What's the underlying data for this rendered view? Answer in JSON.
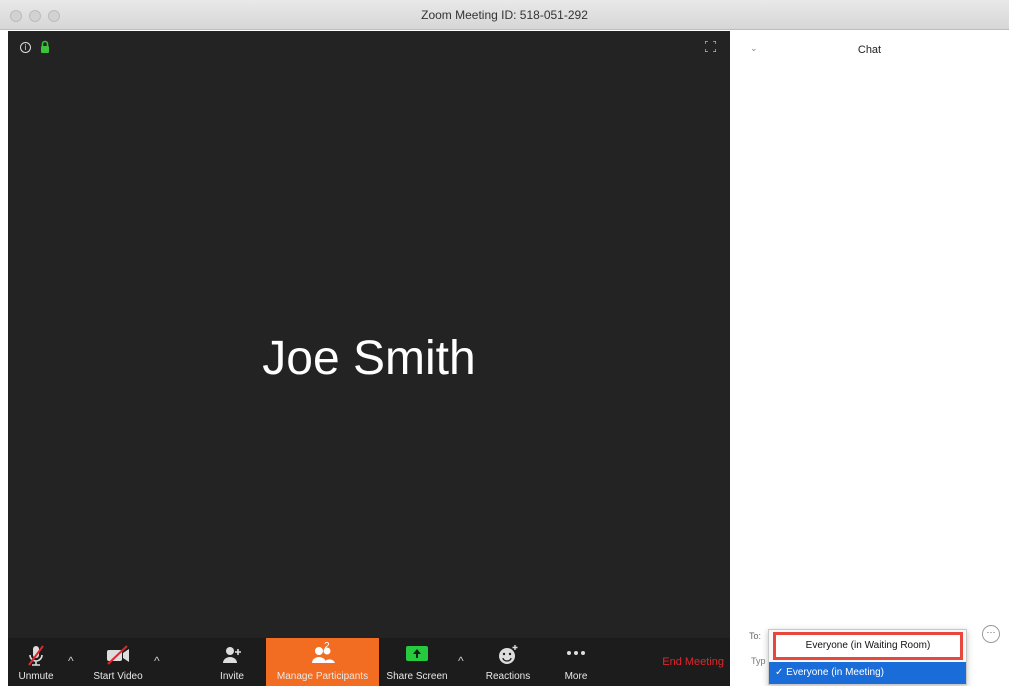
{
  "window": {
    "title": "Zoom Meeting ID: 518-051-292"
  },
  "video": {
    "participant_name": "Joe Smith"
  },
  "toolbar": {
    "unmute": "Unmute",
    "start_video": "Start Video",
    "invite": "Invite",
    "manage_participants": "Manage Participants",
    "participant_count": "2",
    "share_screen": "Share Screen",
    "reactions": "Reactions",
    "more": "More",
    "end_meeting": "End Meeting"
  },
  "chat": {
    "title": "Chat",
    "to_label": "To:",
    "type_label": "Typ",
    "more_label": "···",
    "recipient_options": [
      "Everyone (in Waiting Room)",
      "Everyone (in Meeting)"
    ],
    "selected_check": "✓"
  },
  "colors": {
    "manage_highlight": "#f26d21",
    "end_meeting": "#e0272c",
    "selected_option": "#1a6dd9",
    "callout_border": "#e8473e",
    "share_green": "#27c93f"
  }
}
